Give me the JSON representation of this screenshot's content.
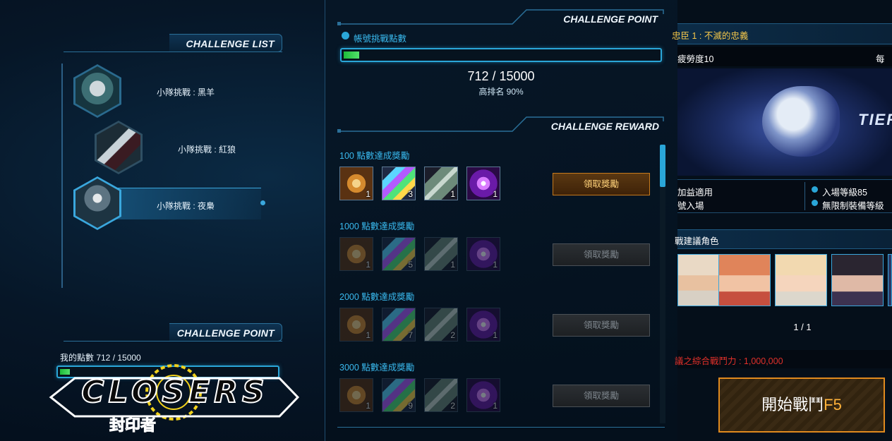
{
  "left": {
    "challenge_list_title": "CHALLENGE LIST",
    "challenges": [
      {
        "label": "小隊挑戰 : 黑羊"
      },
      {
        "label": "小隊挑戰 : 紅狼"
      },
      {
        "label": "小隊挑戰 : 夜梟"
      }
    ],
    "selected_index": 2,
    "challenge_point_title": "CHALLENGE POINT",
    "my_points_label": "我的點數 712 / 15000",
    "my_points_progress": 0.047,
    "logo_text": "CLOSERS",
    "logo_sub": "封印者"
  },
  "middle": {
    "challenge_point_title": "CHALLENGE POINT",
    "account_points_label": "帳號挑戰點數",
    "points_value": "712 / 15000",
    "points_progress": 0.047,
    "rank_text": "高排名 90%",
    "reward_title": "CHALLENGE REWARD",
    "reward_tiers": [
      {
        "title": "100 點數達成獎勵",
        "counts": [
          "1",
          "3",
          "1",
          "1"
        ],
        "button": "領取獎勵",
        "active": true
      },
      {
        "title": "1000 點數達成獎勵",
        "counts": [
          "1",
          "5",
          "1",
          "1"
        ],
        "button": "領取獎勵",
        "active": false
      },
      {
        "title": "2000 點數達成獎勵",
        "counts": [
          "1",
          "7",
          "2",
          "1"
        ],
        "button": "領取獎勵",
        "active": false
      },
      {
        "title": "3000 點數達成獎勵",
        "counts": [
          "1",
          "9",
          "2",
          "1"
        ],
        "button": "領取獎勵",
        "active": false
      }
    ],
    "item_icons": [
      "medal-icon",
      "rainbow-crystal-icon",
      "capsule-icon",
      "purple-burst-icon"
    ]
  },
  "right": {
    "header": "忠臣 1 : 不滅的忠義",
    "difficulty": "疲勞度10",
    "daily": "每日",
    "banner_text": "TIER",
    "info_left_1": "加益適用",
    "info_left_2": "號入場",
    "info_right_1": "入場等級85",
    "info_right_2": "無限制裝備等級",
    "recommended_label": "戰建議角色",
    "page_indicator": "1 / 1",
    "combat_power": "議之綜合戰鬥力 : 1,000,000",
    "start_button": "開始戰鬥",
    "start_key": "F5"
  },
  "colors": {
    "accent": "#2aa6d8",
    "title_blue": "#39b9ee",
    "orange": "#e08a1e",
    "gold_text": "#ffd27a",
    "red_text": "#e0302a",
    "header_yellow": "#f3c64a"
  }
}
